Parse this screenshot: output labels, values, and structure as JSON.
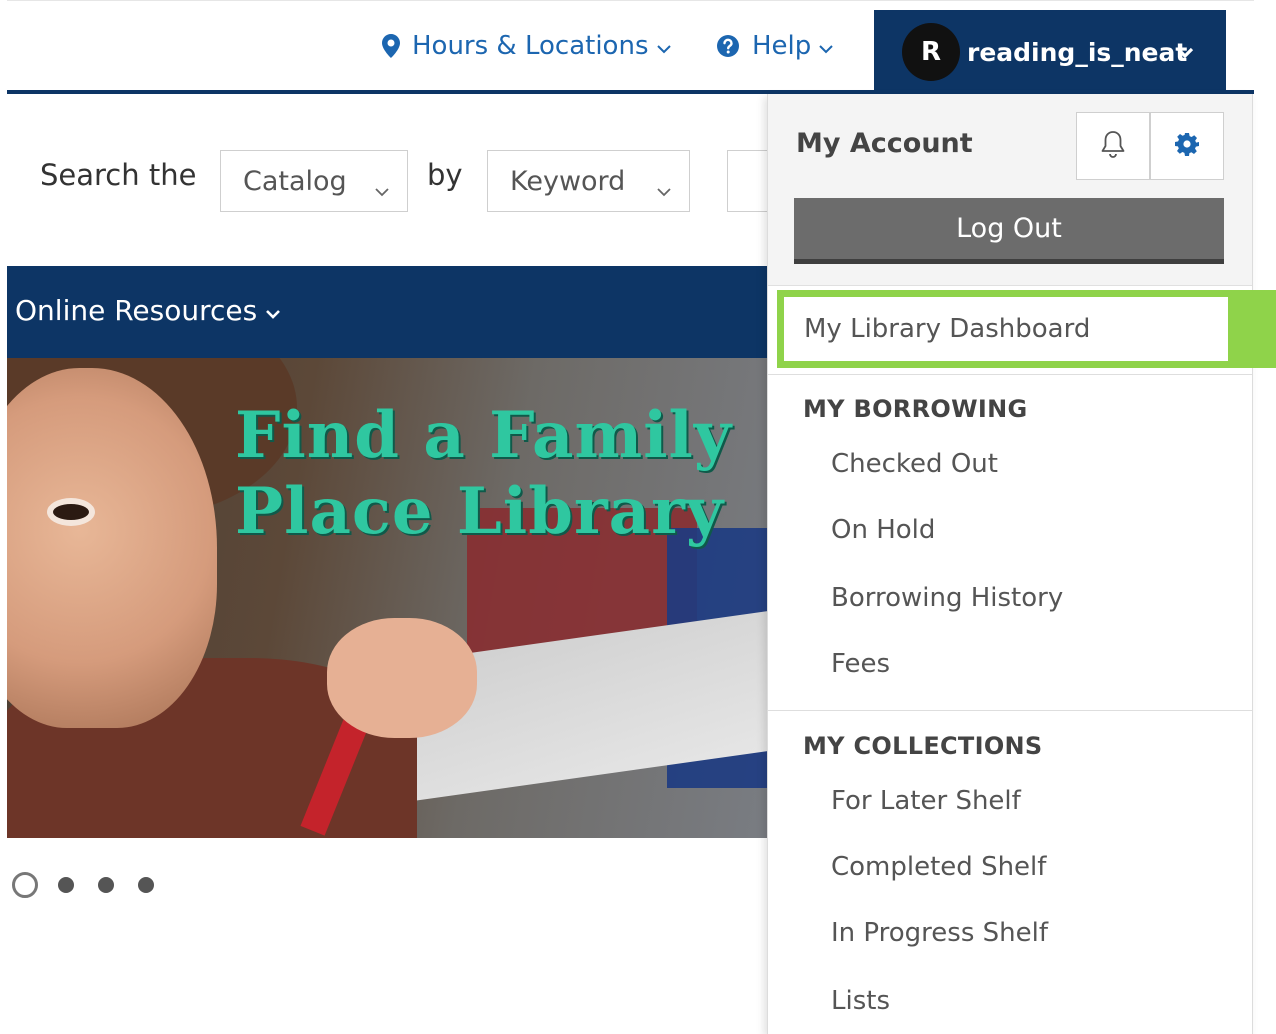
{
  "header": {
    "hours_label": "Hours & Locations",
    "help_label": "Help",
    "account_initial": "R",
    "account_name": "reading_is_neat",
    "colors": {
      "navy": "#0d3565",
      "link": "#1c66b0",
      "highlight": "#8fd34a"
    }
  },
  "search": {
    "label": "Search the",
    "scope_value": "Catalog",
    "by_label": "by",
    "type_value": "Keyword"
  },
  "nav": {
    "online_resources_label": "Online Resources"
  },
  "hero": {
    "title_line1": "Find a Family",
    "title_line2": "Place Library",
    "slide_count": 4,
    "active_slide": 1
  },
  "account_menu": {
    "title": "My Account",
    "bell_icon": "bell-icon",
    "gear_icon": "gear-icon",
    "logout_label": "Log Out",
    "dashboard_label": "My Library Dashboard",
    "borrowing": {
      "heading": "MY BORROWING",
      "items": [
        "Checked Out",
        "On Hold",
        "Borrowing History",
        "Fees"
      ]
    },
    "collections": {
      "heading": "MY COLLECTIONS",
      "items": [
        "For Later Shelf",
        "Completed Shelf",
        "In Progress Shelf",
        "Lists"
      ]
    }
  }
}
